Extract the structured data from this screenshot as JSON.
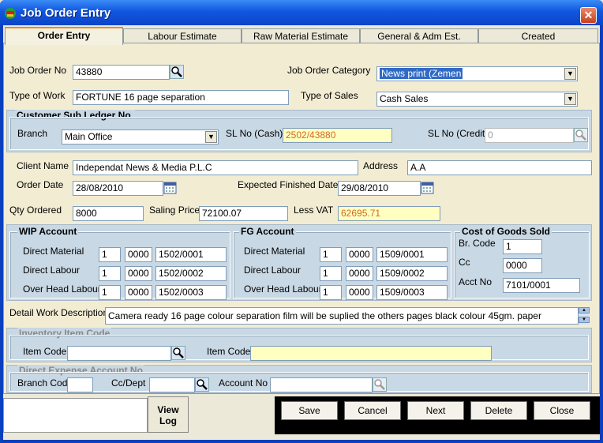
{
  "window": {
    "title": "Job Order Entry",
    "close_label": "✕"
  },
  "tabs": [
    {
      "label": "Order Entry"
    },
    {
      "label": "Labour Estimate"
    },
    {
      "label": "Raw Material Estimate"
    },
    {
      "label": "General & Adm Est."
    },
    {
      "label": "Created"
    }
  ],
  "order": {
    "job_order_no_label": "Job Order No",
    "job_order_no": "43880",
    "category_label": "Job Order Category",
    "category": "News print (Zemen",
    "type_of_work_label": "Type of Work",
    "type_of_work": "FORTUNE 16 page separation",
    "type_of_sales_label": "Type of Sales",
    "type_of_sales": "Cash Sales"
  },
  "customer": {
    "group_title": "Customer Sub Ledger No.",
    "branch_label": "Branch",
    "branch": "Main Office",
    "sl_cash_label": "SL No (Cash)",
    "sl_cash": "2502/43880",
    "sl_credit_label": "SL No (Credit)",
    "sl_credit": "0"
  },
  "client": {
    "client_name_label": "Client Name",
    "client_name": "Independat  News  & Media P.L.C",
    "address_label": "Address",
    "address": "A.A",
    "order_date_label": "Order Date",
    "order_date": "28/08/2010",
    "expected_label": "Expected Finished Date",
    "expected_date": "29/08/2010",
    "qty_label": "Qty Ordered",
    "qty": "8000",
    "saling_price_label": "Saling Price",
    "saling_price": "72100.07",
    "less_vat_label": "Less VAT",
    "less_vat": "62695.71"
  },
  "wip": {
    "title": "WIP Account",
    "rows": [
      {
        "label": "Direct Material",
        "a": "1",
        "b": "0000",
        "c": "1502/0001"
      },
      {
        "label": "Direct Labour",
        "a": "1",
        "b": "0000",
        "c": "1502/0002"
      },
      {
        "label": "Over Head Labour",
        "a": "1",
        "b": "0000",
        "c": "1502/0003"
      }
    ]
  },
  "fg": {
    "title": "FG Account",
    "rows": [
      {
        "label": "Direct Material",
        "a": "1",
        "b": "0000",
        "c": "1509/0001"
      },
      {
        "label": "Direct Labour",
        "a": "1",
        "b": "0000",
        "c": "1509/0002"
      },
      {
        "label": "Over Head Labour",
        "a": "1",
        "b": "0000",
        "c": "1509/0003"
      }
    ]
  },
  "cogs": {
    "title": "Cost of Goods Sold",
    "br_code_label": "Br. Code",
    "br_code": "1",
    "cc_label": "Cc",
    "cc": "0000",
    "acct_no_label": "Acct No",
    "acct_no": "7101/0001"
  },
  "detail": {
    "label": "Detail Work Description",
    "text": "Camera  ready  16  page  colour  separation  film  will  be  suplied  the  others  pages  black  colour  45gm.  paper"
  },
  "inventory": {
    "title": "Inventory Item Code",
    "item_code_label": "Item Code:",
    "item_code": "",
    "item_code2_label": "Item Code:",
    "item_code2": ""
  },
  "direct_expense": {
    "title": "Direct Expense Account No",
    "branch_code_label": "Branch Code",
    "branch_code": "",
    "cc_dept_label": "Cc/Dept",
    "cc_dept": "",
    "account_no_label": "Account No",
    "account_no": ""
  },
  "footer": {
    "view_log_line1": "View",
    "view_log_line2": "Log",
    "save": "Save",
    "cancel": "Cancel",
    "next": "Next",
    "delete": "Delete",
    "close": "Close"
  },
  "colors": {
    "title_bar": "#1156e0",
    "group_bg": "#c8d8e4",
    "highlight": "#316ac5",
    "yellow_field": "#ffffc2",
    "vat_text": "#d2691e"
  },
  "icons": {
    "lookup": "magnifier-icon",
    "calendar": "calendar-icon",
    "app": "app-icon"
  }
}
